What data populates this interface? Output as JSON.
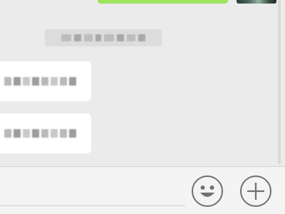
{
  "chat": {
    "outgoing_message": {
      "color": "#9ee45f"
    },
    "timestamp": {
      "text": "",
      "obscured": true
    },
    "incoming_messages": [
      {
        "text": "",
        "obscured": true
      },
      {
        "text": "",
        "obscured": true
      }
    ]
  },
  "input_bar": {
    "message_input": {
      "value": "",
      "placeholder": ""
    },
    "emoji_icon": "smiley-face-icon",
    "more_icon": "plus-icon"
  },
  "colors": {
    "chat_background": "#ebebeb",
    "incoming_bubble": "#ffffff",
    "outgoing_bubble": "#9ee45f",
    "input_bar_background": "#f4f4f4",
    "icon_stroke": "#707070"
  }
}
